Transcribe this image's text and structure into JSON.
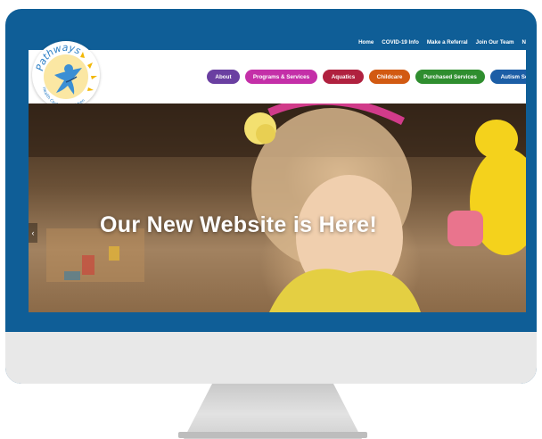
{
  "topnav": {
    "links": [
      "Home",
      "COVID-19 Info",
      "Make a Referral",
      "Join Our Team",
      "N"
    ]
  },
  "logo": {
    "name": "Pathways",
    "tagline": "Health Centre for Children"
  },
  "mainnav": {
    "items": [
      {
        "label": "About",
        "color": "#6a3fa1"
      },
      {
        "label": "Programs & Services",
        "color": "#c42fa8"
      },
      {
        "label": "Aquatics",
        "color": "#b0213f"
      },
      {
        "label": "Childcare",
        "color": "#d25a12"
      },
      {
        "label": "Purchased Services",
        "color": "#2f8e2f"
      },
      {
        "label": "Autism Serv",
        "color": "#1c5ea6"
      }
    ]
  },
  "hero": {
    "title": "Our New Website is Here!",
    "prev_arrow": "‹"
  },
  "colors": {
    "frame": "#0f5e97",
    "chin": "#e8e8e8"
  }
}
